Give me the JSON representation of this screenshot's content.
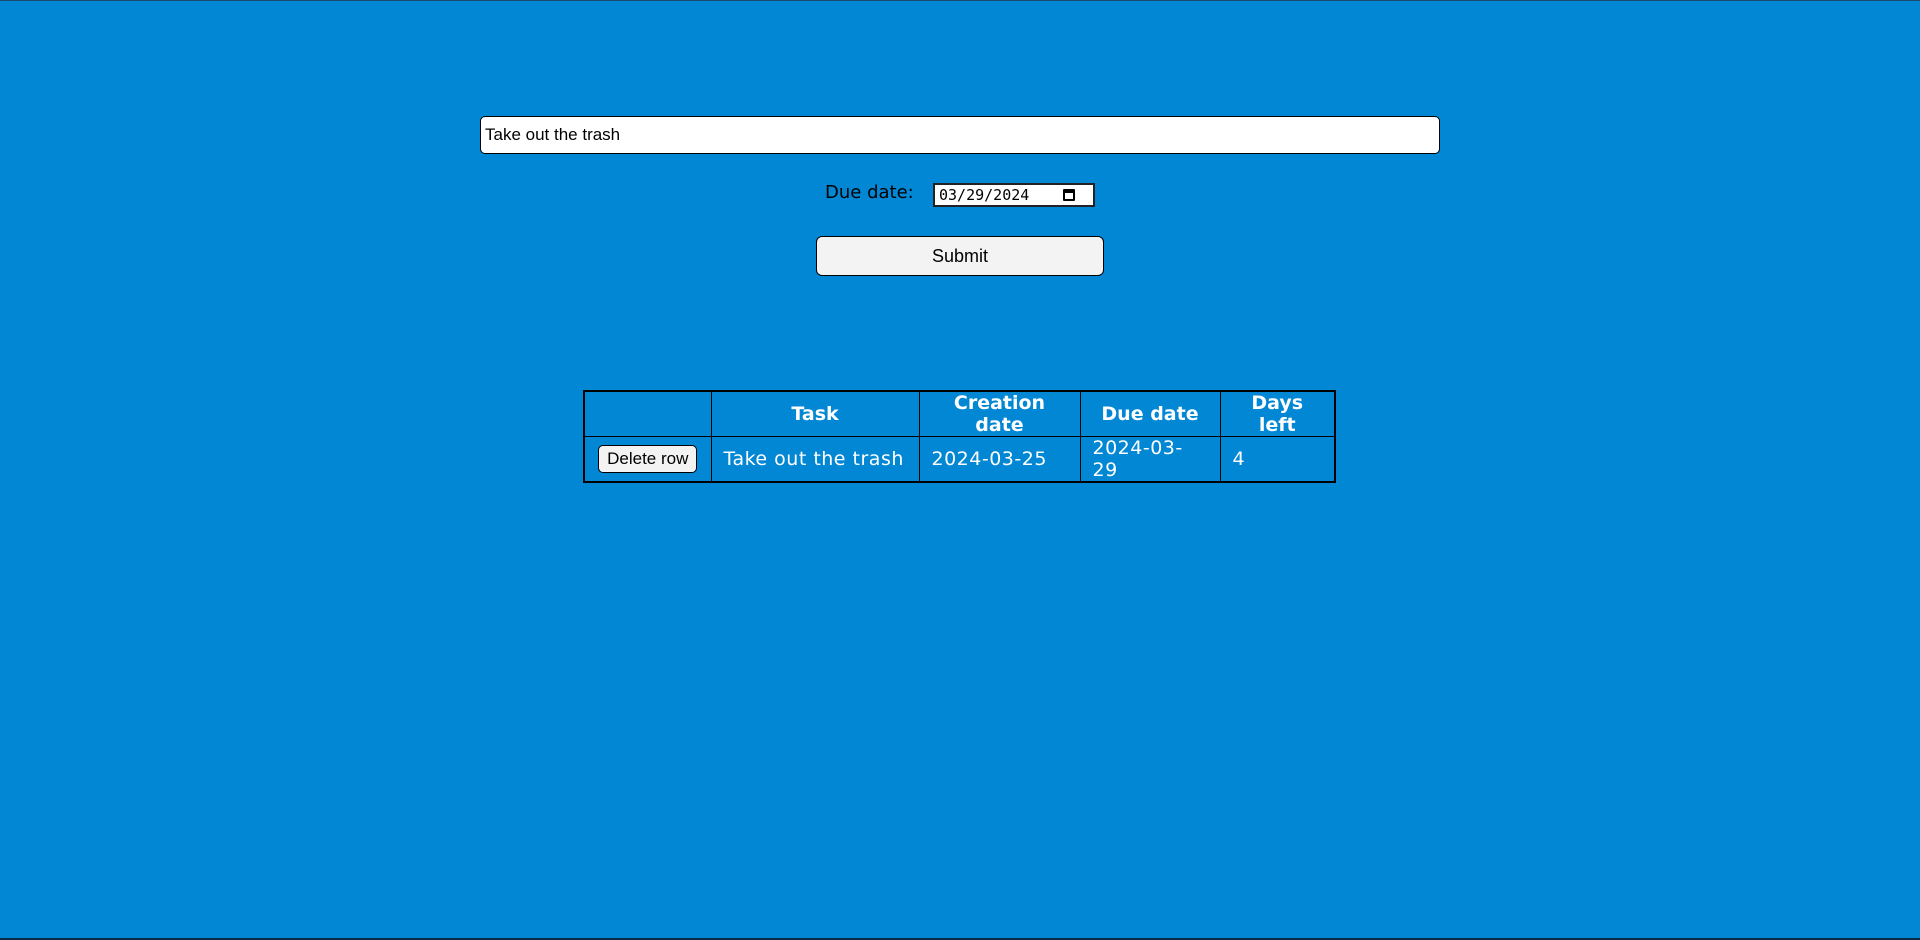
{
  "form": {
    "task_value": "Take out the trash",
    "due_label": "Due date:",
    "due_value": "03/29/2024",
    "submit_label": "Submit"
  },
  "table": {
    "headers": [
      "",
      "Task",
      "Creation date",
      "Due date",
      "Days left"
    ],
    "rows": [
      {
        "action_label": "Delete row",
        "task": "Take out the trash",
        "creation_date": "2024-03-25",
        "due_date": "2024-03-29",
        "days_left": "4"
      }
    ]
  },
  "colors": {
    "background": "#0287d4",
    "button_bg": "#f3f3f3",
    "text_light": "#ffffff"
  },
  "icons": {
    "date_picker": "calendar-icon"
  }
}
